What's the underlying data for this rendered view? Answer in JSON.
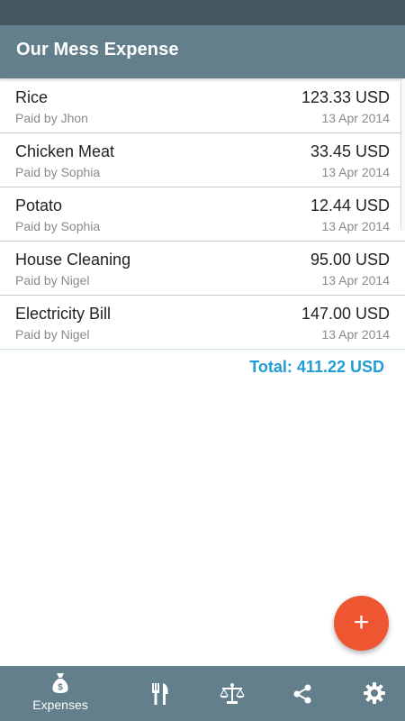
{
  "app": {
    "title": "Our Mess Expense"
  },
  "expenses": [
    {
      "name": "Rice",
      "paid_by": "Paid by Jhon",
      "amount": "123.33 USD",
      "date": "13 Apr 2014"
    },
    {
      "name": "Chicken Meat",
      "paid_by": "Paid by Sophia",
      "amount": "33.45 USD",
      "date": "13 Apr 2014"
    },
    {
      "name": "Potato",
      "paid_by": "Paid by Sophia",
      "amount": "12.44 USD",
      "date": "13 Apr 2014"
    },
    {
      "name": "House Cleaning",
      "paid_by": "Paid by Nigel",
      "amount": "95.00 USD",
      "date": "13 Apr 2014"
    },
    {
      "name": "Electricity Bill",
      "paid_by": "Paid by Nigel",
      "amount": "147.00 USD",
      "date": "13 Apr 2014"
    }
  ],
  "summary": {
    "total": "Total: 411.22 USD"
  },
  "fab": {
    "icon": "plus-icon",
    "glyph": "+"
  },
  "bottom_nav": {
    "items": [
      {
        "icon": "money-bag-icon",
        "label": "Expenses"
      },
      {
        "icon": "fork-knife-icon"
      },
      {
        "icon": "balance-scale-icon"
      },
      {
        "icon": "share-icon"
      },
      {
        "icon": "gear-icon"
      }
    ]
  },
  "colors": {
    "status_bar": "#46585f",
    "app_bar": "#627f8b",
    "total_text": "#1e9dd6",
    "fab": "#ee5631"
  }
}
